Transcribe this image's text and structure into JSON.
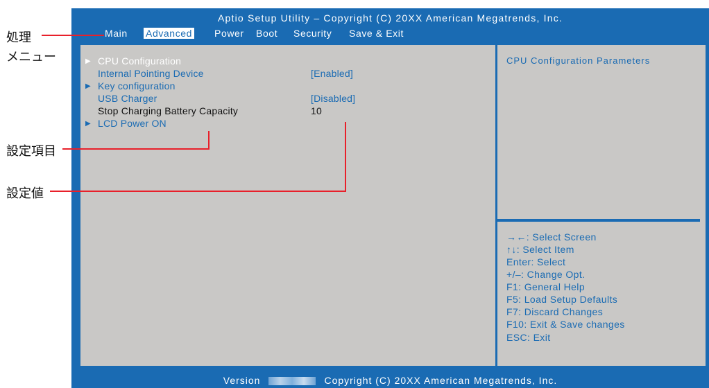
{
  "title": "Aptio Setup Utility – Copyright (C) 20XX American Megatrends, Inc.",
  "menu": [
    "Main",
    "Advanced",
    "Power",
    "Boot",
    "Security",
    "Save & Exit"
  ],
  "active_menu": "Advanced",
  "settings": [
    {
      "label": "CPU Configuration",
      "value": "",
      "submenu": true,
      "selected": true
    },
    {
      "label": "Internal Pointing Device",
      "value": "[Enabled]",
      "submenu": false
    },
    {
      "label": "Key configuration",
      "value": "",
      "submenu": true
    },
    {
      "label": "USB Charger",
      "value": "[Disabled]",
      "submenu": false
    },
    {
      "label": "Stop Charging Battery Capacity",
      "value": "10",
      "submenu": false,
      "readonly": true
    },
    {
      "label": "LCD Power ON",
      "value": "",
      "submenu": true
    }
  ],
  "help_title": "CPU Configuration Parameters",
  "keys": [
    "→←: Select Screen",
    "↑↓: Select Item",
    "Enter: Select",
    "+/–: Change Opt.",
    "F1: General Help",
    "F5: Load Setup Defaults",
    "F7: Discard Changes",
    "F10: Exit & Save changes",
    "ESC: Exit"
  ],
  "footer": {
    "left": "Version",
    "right": "Copyright (C) 20XX American Megatrends, Inc."
  },
  "annotations": {
    "menu": "処理\nメニュー",
    "item": "設定項目",
    "value": "設定値"
  },
  "colors": {
    "bios_blue": "#1a6bb3",
    "panel_gray": "#c9c8c6",
    "callout_red": "#e8202a"
  }
}
